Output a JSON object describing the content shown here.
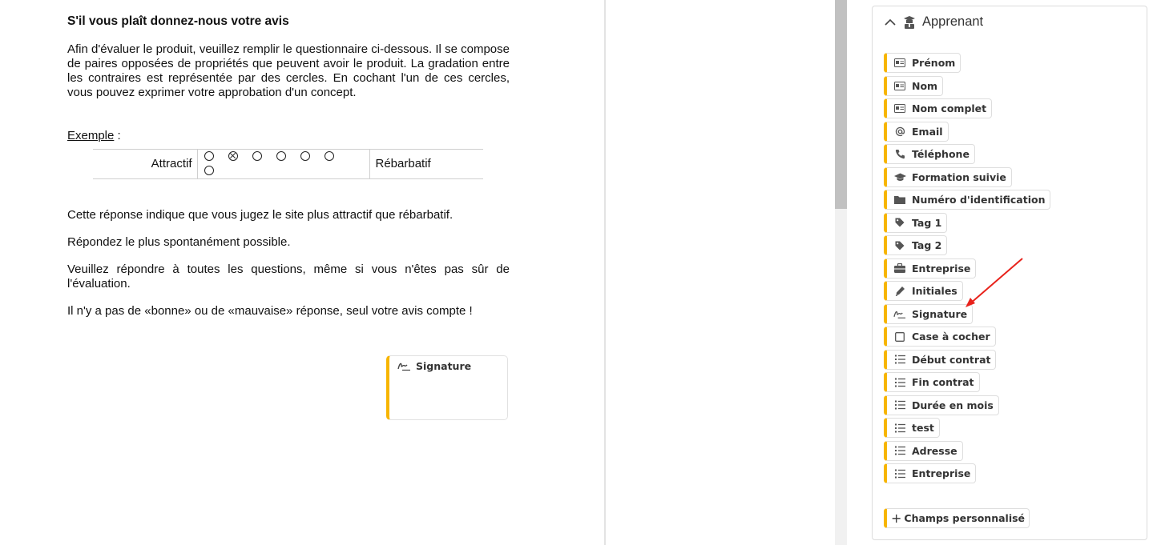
{
  "document": {
    "title": "S'il vous plaît donnez-nous votre avis",
    "intro": "Afin d'évaluer le produit, veuillez remplir le questionnaire ci-dessous. Il se compose de paires opposées de propriétés que peuvent avoir le produit. La gradation entre les contraires est représentée par des cercles. En cochant l'un de ces cercles, vous pouvez exprimer votre approbation d'un concept.",
    "example_label": "Exemple",
    "example_suffix": " :",
    "example": {
      "left": "Attractif",
      "right": "Rébarbatif",
      "circles": 7,
      "checked_index": 1
    },
    "paragraphs": [
      "Cette réponse indique que vous jugez le site plus attractif que rébarbatif.",
      "Répondez le plus spontanément possible.",
      "Veuillez répondre à toutes les questions, même si vous n'êtes pas sûr de l'évaluation.",
      "Il n'y a pas de «bonne» ou de «mauvaise» réponse, seul votre avis compte !"
    ],
    "signature_field_label": "Signature"
  },
  "panel": {
    "title": "Apprenant",
    "fields": [
      {
        "label": "Prénom",
        "icon": "id-card-icon"
      },
      {
        "label": "Nom",
        "icon": "id-card-icon"
      },
      {
        "label": "Nom complet",
        "icon": "id-card-icon"
      },
      {
        "label": "Email",
        "icon": "at-icon"
      },
      {
        "label": "Téléphone",
        "icon": "phone-icon"
      },
      {
        "label": "Formation suivie",
        "icon": "graduation-cap-icon"
      },
      {
        "label": "Numéro d'identification",
        "icon": "folder-icon"
      },
      {
        "label": "Tag 1",
        "icon": "tag-icon"
      },
      {
        "label": "Tag 2",
        "icon": "tag-icon"
      },
      {
        "label": "Entreprise",
        "icon": "briefcase-icon"
      },
      {
        "label": "Initiales",
        "icon": "pen-icon"
      },
      {
        "label": "Signature",
        "icon": "signature-icon"
      },
      {
        "label": "Case à cocher",
        "icon": "checkbox-icon"
      },
      {
        "label": "Début contrat",
        "icon": "list-icon"
      },
      {
        "label": "Fin contrat",
        "icon": "list-icon"
      },
      {
        "label": "Durée en mois",
        "icon": "list-icon"
      },
      {
        "label": "test",
        "icon": "list-icon"
      },
      {
        "label": "Adresse",
        "icon": "list-icon"
      },
      {
        "label": "Entreprise",
        "icon": "list-icon"
      }
    ],
    "add_custom_label": "Champs personnalisé"
  },
  "colors": {
    "accent": "#f7b500",
    "annotation_arrow": "#e8221b"
  }
}
